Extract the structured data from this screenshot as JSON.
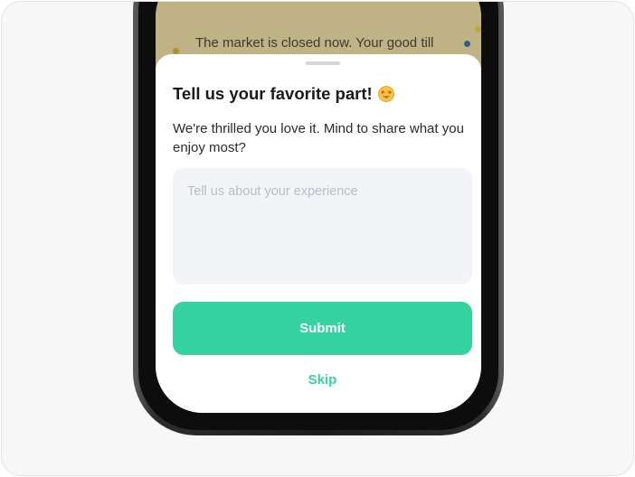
{
  "background_app": {
    "banner_text": "The market is closed now. Your good till"
  },
  "sheet": {
    "title": "Tell us your favorite part!",
    "title_icon": "star-struck-emoji-icon",
    "subtitle": "We're thrilled you love it. Mind to share what you enjoy most?",
    "feedback_input": {
      "value": "",
      "placeholder": "Tell us about your experience"
    },
    "submit_label": "Submit",
    "skip_label": "Skip"
  },
  "colors": {
    "accent": "#34d39f",
    "input_bg": "#f3f4f8",
    "placeholder": "#b9bcc4"
  }
}
